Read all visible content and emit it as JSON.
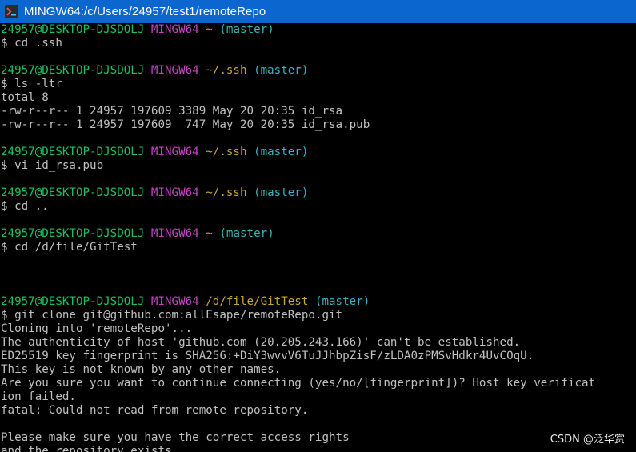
{
  "window": {
    "title": "MINGW64:/c/Users/24957/test1/remoteRepo",
    "icon": "git-bash-icon"
  },
  "colors": {
    "user_host": "#19c35c",
    "shell": "#c444c4",
    "path": "#c9a72a",
    "branch": "#34b6c3",
    "text": "#c0c0c0",
    "titlebar": "#0b66d0"
  },
  "terminal": {
    "lines": [
      {
        "type": "prompt",
        "user": "24957@DESKTOP-DJSDOLJ",
        "shell": "MINGW64",
        "path": "~",
        "branch": "(master)"
      },
      {
        "type": "text",
        "text": "$ cd .ssh"
      },
      {
        "type": "text",
        "text": ""
      },
      {
        "type": "prompt",
        "user": "24957@DESKTOP-DJSDOLJ",
        "shell": "MINGW64",
        "path": "~/.ssh",
        "branch": "(master)"
      },
      {
        "type": "text",
        "text": "$ ls -ltr"
      },
      {
        "type": "text",
        "text": "total 8"
      },
      {
        "type": "text",
        "text": "-rw-r--r-- 1 24957 197609 3389 May 20 20:35 id_rsa"
      },
      {
        "type": "text",
        "text": "-rw-r--r-- 1 24957 197609  747 May 20 20:35 id_rsa.pub"
      },
      {
        "type": "text",
        "text": ""
      },
      {
        "type": "prompt",
        "user": "24957@DESKTOP-DJSDOLJ",
        "shell": "MINGW64",
        "path": "~/.ssh",
        "branch": "(master)"
      },
      {
        "type": "text",
        "text": "$ vi id_rsa.pub"
      },
      {
        "type": "text",
        "text": ""
      },
      {
        "type": "prompt",
        "user": "24957@DESKTOP-DJSDOLJ",
        "shell": "MINGW64",
        "path": "~/.ssh",
        "branch": "(master)"
      },
      {
        "type": "text",
        "text": "$ cd .."
      },
      {
        "type": "text",
        "text": ""
      },
      {
        "type": "prompt",
        "user": "24957@DESKTOP-DJSDOLJ",
        "shell": "MINGW64",
        "path": "~",
        "branch": "(master)"
      },
      {
        "type": "text",
        "text": "$ cd /d/file/GitTest"
      },
      {
        "type": "text",
        "text": ""
      },
      {
        "type": "text",
        "text": ""
      },
      {
        "type": "text",
        "text": ""
      },
      {
        "type": "prompt",
        "user": "24957@DESKTOP-DJSDOLJ",
        "shell": "MINGW64",
        "path": "/d/file/GitTest",
        "branch": "(master)"
      },
      {
        "type": "text",
        "text": "$ git clone git@github.com:allEsape/remoteRepo.git"
      },
      {
        "type": "text",
        "text": "Cloning into 'remoteRepo'..."
      },
      {
        "type": "text",
        "text": "The authenticity of host 'github.com (20.205.243.166)' can't be established."
      },
      {
        "type": "text",
        "text": "ED25519 key fingerprint is SHA256:+DiY3wvvV6TuJJhbpZisF/zLDA0zPMSvHdkr4UvCOqU."
      },
      {
        "type": "text",
        "text": "This key is not known by any other names."
      },
      {
        "type": "text",
        "text": "Are you sure you want to continue connecting (yes/no/[fingerprint])? Host key verificat"
      },
      {
        "type": "text",
        "text": "ion failed."
      },
      {
        "type": "text",
        "text": "fatal: Could not read from remote repository."
      },
      {
        "type": "text",
        "text": ""
      },
      {
        "type": "text",
        "text": "Please make sure you have the correct access rights"
      },
      {
        "type": "text",
        "text": "and the repository exists."
      }
    ]
  },
  "watermark": {
    "text": "CSDN @泛华赏"
  }
}
